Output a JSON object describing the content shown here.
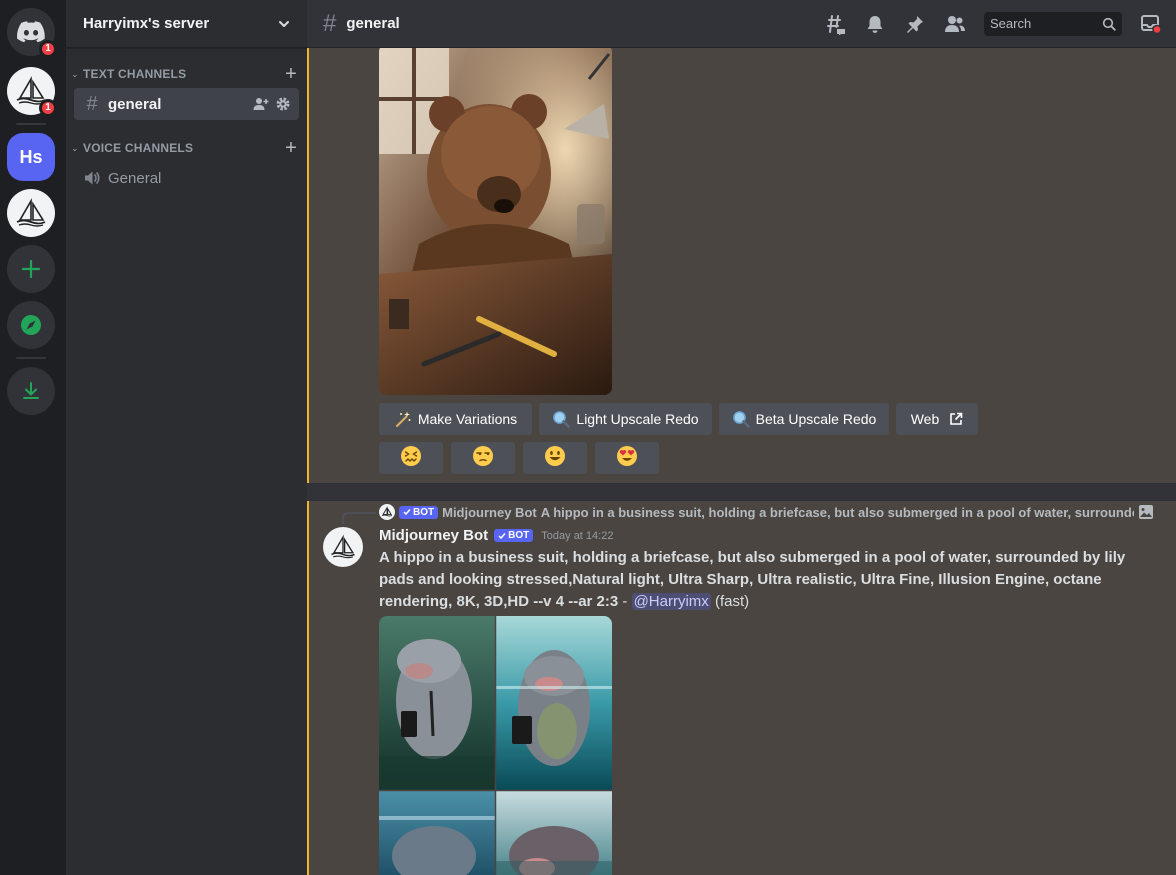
{
  "server_rail": {
    "home_badge": "1",
    "midjourney_badge": "1",
    "hs_initials": "Hs"
  },
  "sidebar": {
    "server_name": "Harryimx's server",
    "text_category": "TEXT CHANNELS",
    "voice_category": "VOICE CHANNELS",
    "text_channels": [
      {
        "label": "general",
        "active": true
      }
    ],
    "voice_channels": [
      {
        "label": "General"
      }
    ]
  },
  "topbar": {
    "channel_name": "general",
    "search_placeholder": "Search"
  },
  "message1": {
    "buttons": [
      {
        "label": "Make Variations",
        "icon": "magic-wand-icon"
      },
      {
        "label": "Light Upscale Redo",
        "icon": "magnifier-icon"
      },
      {
        "label": "Beta Upscale Redo",
        "icon": "magnifier-icon"
      },
      {
        "label": "Web",
        "icon": "external-link-icon"
      }
    ],
    "reactions": [
      {
        "emoji": "😖",
        "name": "confounded-face"
      },
      {
        "emoji": "😒",
        "name": "unamused-face"
      },
      {
        "emoji": "😀",
        "name": "grinning-face"
      },
      {
        "emoji": "😍",
        "name": "heart-eyes-face"
      }
    ]
  },
  "message2": {
    "reply": {
      "bot_tag": "BOT",
      "author": "Midjourney Bot",
      "text": "A hippo in a business suit, holding a briefcase, but also submerged in a pool of water, surrounde"
    },
    "author": "Midjourney Bot",
    "bot_tag": "BOT",
    "timestamp": "Today at 14:22",
    "prompt": "A hippo in a business suit, holding a briefcase, but also submerged in a pool of water, surrounded by lily pads and looking stressed,Natural light, Ultra Sharp, Ultra realistic, Ultra Fine, Illusion Engine, octane rendering, 8K, 3D,HD --v 4 --ar 2:3",
    "separator": " - ",
    "mention": "@Harryimx",
    "speed": "(fast)"
  },
  "colors": {
    "blurple": "#5865f2",
    "mention_highlight": "#f0b232",
    "danger": "#f23f43",
    "green": "#23a559"
  }
}
